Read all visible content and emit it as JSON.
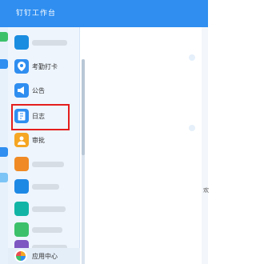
{
  "topbar": {
    "title": "钉钉工作台"
  },
  "sidebar": {
    "items": [
      {
        "icon": "blurred-app-icon",
        "label": "",
        "color": "#1a8de0"
      },
      {
        "icon": "location-pin-icon",
        "label": "考勤打卡",
        "color": "#2f8ef0"
      },
      {
        "icon": "megaphone-icon",
        "label": "公告",
        "color": "#2f8ef0"
      },
      {
        "icon": "notebook-icon",
        "label": "日志",
        "color": "#2f8ef0"
      },
      {
        "icon": "approval-person-icon",
        "label": "审批",
        "color": "#f5a623"
      },
      {
        "icon": "blurred-app-icon",
        "label": "",
        "color": "#f08a24"
      },
      {
        "icon": "blurred-app-icon",
        "label": "",
        "color": "#1e88e5"
      },
      {
        "icon": "blurred-app-icon",
        "label": "",
        "color": "#12b5a5"
      },
      {
        "icon": "blurred-app-icon",
        "label": "",
        "color": "#3cc16a"
      },
      {
        "icon": "blurred-app-icon",
        "label": "",
        "color": "#7e57c2"
      },
      {
        "icon": "blurred-app-icon",
        "label": "",
        "color": "#29b35a"
      }
    ]
  },
  "footer": {
    "app_center_label": "应用中心"
  },
  "right_panel": {
    "partial_text": "欢"
  }
}
